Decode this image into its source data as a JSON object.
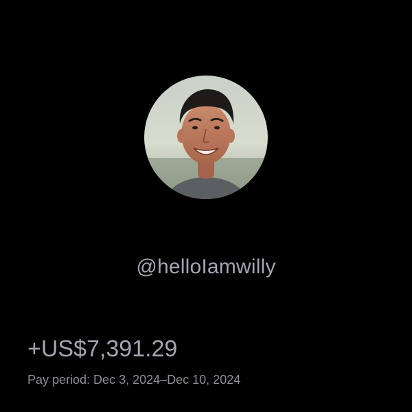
{
  "profile": {
    "username": "@helloIamwilly",
    "avatar_icon": "profile-photo"
  },
  "payout": {
    "amount": "+US$7,391.29",
    "period": "Pay period: Dec 3, 2024–Dec 10, 2024"
  },
  "colors": {
    "background": "#000000",
    "text_primary": "#a4a4b2",
    "text_secondary": "#8e8e99"
  }
}
